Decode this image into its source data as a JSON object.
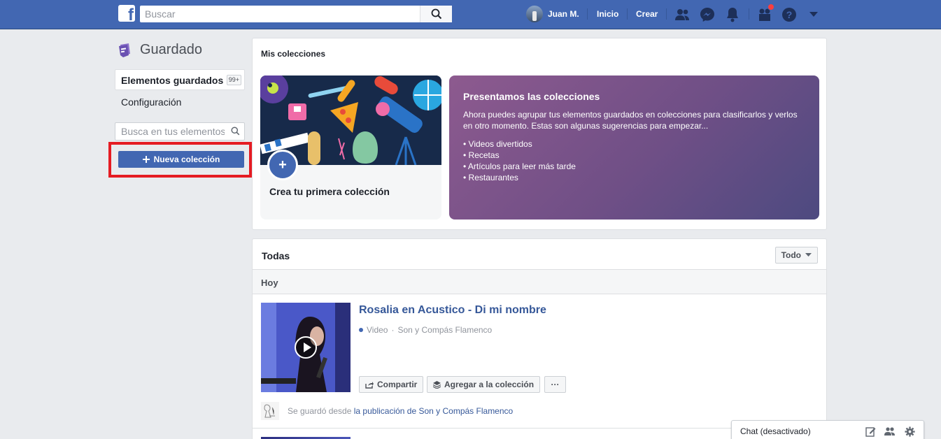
{
  "header": {
    "search_placeholder": "Buscar",
    "user_name": "Juan M.",
    "nav_home": "Inicio",
    "nav_create": "Crear",
    "icons": [
      "friend-requests-icon",
      "messenger-icon",
      "notifications-icon",
      "groups-icon",
      "help-icon",
      "caret-down-icon"
    ]
  },
  "sidebar": {
    "title": "Guardado",
    "active_item": {
      "label": "Elementos guardados",
      "count": "99+"
    },
    "config_label": "Configuración",
    "search_placeholder": "Busca en tus elementos guardados",
    "new_collection_label": "Nueva colección"
  },
  "collections": {
    "header": "Mis colecciones",
    "first_collection_caption": "Crea tu primera colección",
    "plus_symbol": "+",
    "promo": {
      "title": "Presentamos las colecciones",
      "description": "Ahora puedes agrupar tus elementos guardados en colecciones para clasificarlos y verlos en otro momento. Estas son algunas sugerencias para empezar...",
      "suggestions": [
        "Videos divertidos",
        "Recetas",
        "Artículos para leer más tarde",
        "Restaurantes"
      ]
    }
  },
  "all_items": {
    "header": "Todas",
    "filter_label": "Todo",
    "day_label": "Hoy",
    "items": [
      {
        "title": "Rosalia en Acustico - Di mi nombre",
        "type": "Video",
        "source": "Son y Compás Flamenco",
        "share_label": "Compartir",
        "add_to_collection_label": "Agregar a la colección",
        "more_label": "···",
        "saved_from_prefix": "Se guardó desde",
        "saved_from_link": "la publicación de Son y Compás Flamenco"
      }
    ]
  },
  "chat": {
    "label": "Chat (desactivado)",
    "icons": [
      "compose-icon",
      "new-group-icon",
      "settings-icon"
    ]
  },
  "colors": {
    "brand_blue": "#4267b2",
    "highlight_red": "#e51c23",
    "link_blue": "#365899",
    "page_bg": "#e9ebee"
  }
}
